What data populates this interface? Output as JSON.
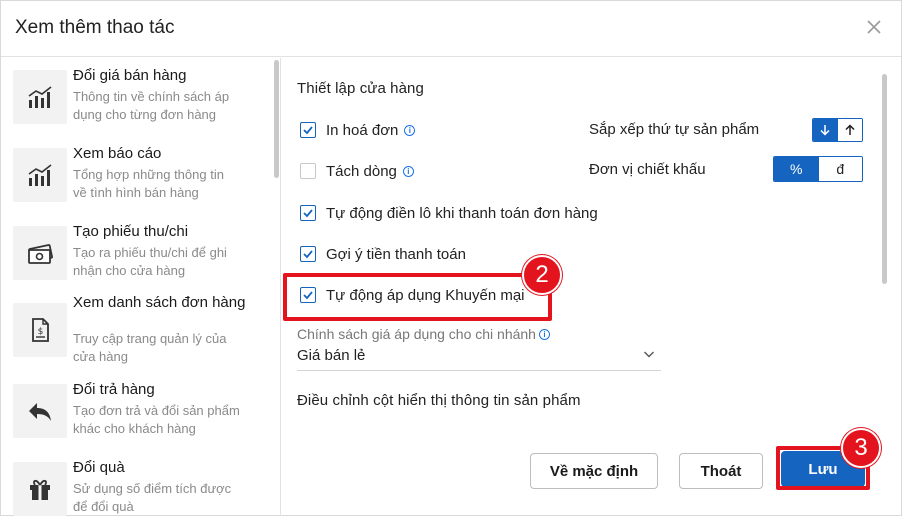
{
  "dialog": {
    "title": "Xem thêm thao tác",
    "close_icon": "close-icon"
  },
  "sidebar": {
    "items": [
      {
        "title": "Đổi giá bán hàng",
        "desc1": "Thông tin về chính sách áp",
        "desc2": "dụng cho từng đơn hàng",
        "icon": "bar-chart-icon"
      },
      {
        "title": "Xem báo cáo",
        "desc1": "Tổng hợp những thông tin",
        "desc2": "về tình hình bán hàng",
        "icon": "bar-chart-icon"
      },
      {
        "title": "Tạo phiếu thu/chi",
        "desc1": "Tạo ra phiếu thu/chi để ghi",
        "desc2": "nhận cho cửa hàng",
        "icon": "money-icon"
      },
      {
        "title": "Xem danh sách đơn hàng",
        "desc1": "Truy cập trang quản lý của",
        "desc2": "cửa hàng",
        "icon": "invoice-icon"
      },
      {
        "title": "Đổi trả hàng",
        "desc1": "Tạo đơn trả và đổi sản phẩm",
        "desc2": "khác cho khách hàng",
        "icon": "reply-arrow-icon"
      },
      {
        "title": "Đổi quà",
        "desc1": "Sử dụng số điểm tích được",
        "desc2": "để đổi quà",
        "icon": "gift-icon"
      }
    ]
  },
  "settings": {
    "section_title": "Thiết lập cửa hàng",
    "checkboxes": [
      {
        "label": "In hoá đơn",
        "checked": true,
        "info": true
      },
      {
        "label": "Tách dòng",
        "checked": false,
        "info": true
      },
      {
        "label": "Tự động điền lô khi thanh toán đơn hàng",
        "checked": true,
        "info": false
      },
      {
        "label": "Gợi ý tiền thanh toán",
        "checked": true,
        "info": false
      },
      {
        "label": "Tự động áp dụng Khuyến mại",
        "checked": true,
        "info": false
      }
    ],
    "sort_label": "Sắp xếp thứ tự sản phẩm",
    "discount_label": "Đơn vị chiết khấu",
    "discount_options": [
      "%",
      "đ"
    ],
    "price_policy_label": "Chính sách giá áp dụng cho chi nhánh",
    "price_policy_value": "Giá bán lẻ",
    "columns_title": "Điều chỉnh cột hiển thị thông tin sản phẩm"
  },
  "footer": {
    "default_label": "Về mặc định",
    "exit_label": "Thoát",
    "save_label": "Lưu"
  },
  "annotations": {
    "step2": "2",
    "step3": "3"
  },
  "colors": {
    "primary": "#1565c0",
    "highlight": "#e4141e"
  }
}
